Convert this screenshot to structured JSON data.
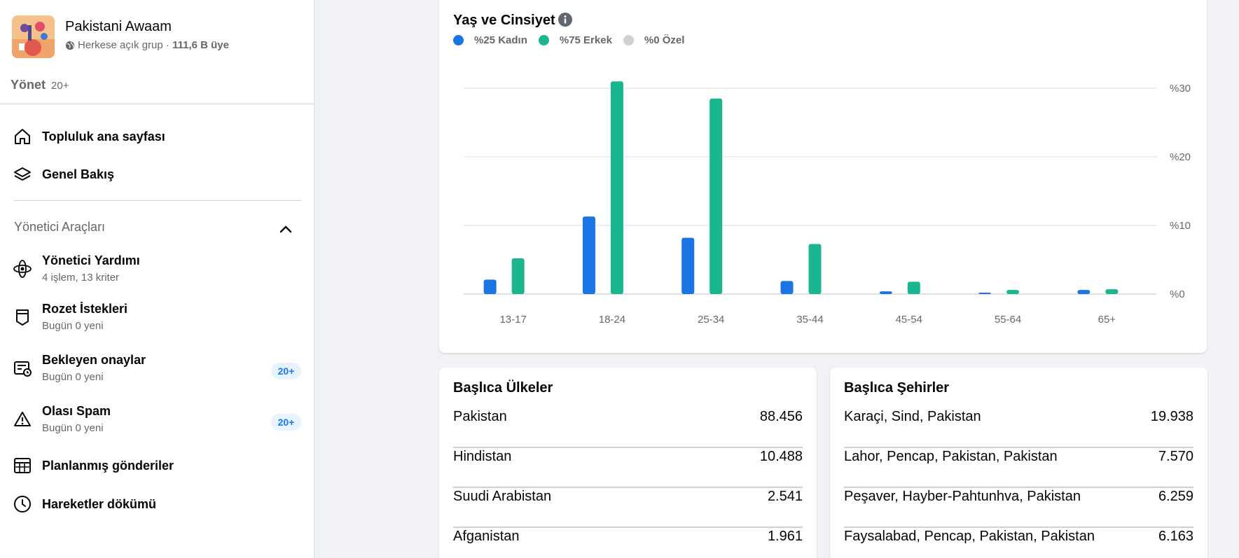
{
  "group": {
    "name": "Pakistani Awaam",
    "privacy": "Herkese açık grup",
    "separator": " · ",
    "members": "111,6 B üye"
  },
  "manage": {
    "label": "Yönet",
    "count": "20+"
  },
  "nav_main": [
    {
      "label": "Topluluk ana sayfası",
      "icon": "home-icon"
    },
    {
      "label": "Genel Bakış",
      "icon": "layers-icon"
    }
  ],
  "admin_tools": {
    "title": "Yönetici Araçları",
    "items": [
      {
        "label": "Yönetici Yardımı",
        "sub": "4 işlem, 13 kriter",
        "icon": "admin-assist-icon"
      },
      {
        "label": "Rozet İstekleri",
        "sub": "Bugün 0 yeni",
        "icon": "badge-icon"
      },
      {
        "label": "Bekleyen onaylar",
        "sub": "Bugün 0 yeni",
        "icon": "pending-icon",
        "badge": "20+"
      },
      {
        "label": "Olası Spam",
        "sub": "Bugün 0 yeni",
        "icon": "warning-icon",
        "badge": "20+"
      },
      {
        "label": "Planlanmış gönderiler",
        "icon": "calendar-icon"
      },
      {
        "label": "Hareketler dökümü",
        "icon": "clock-icon"
      }
    ]
  },
  "colors": {
    "women": "#1b74e4",
    "men": "#1ab690",
    "custom": "#ced0d4",
    "badge_text": "#1877f2"
  },
  "chart_title": "Yaş ve Cinsiyet",
  "legend": [
    {
      "label": "%25 Kadın",
      "color": "#1b74e4"
    },
    {
      "label": "%75 Erkek",
      "color": "#1ab690"
    },
    {
      "label": "%0 Özel",
      "color": "#ced0d4"
    }
  ],
  "chart_data": {
    "type": "bar",
    "title": "Yaş ve Cinsiyet",
    "categories": [
      "13-17",
      "18-24",
      "25-34",
      "35-44",
      "45-54",
      "55-64",
      "65+"
    ],
    "series": [
      {
        "name": "%25 Kadın",
        "values": [
          2.1,
          11.3,
          8.2,
          1.9,
          0.4,
          0.2,
          0.6
        ]
      },
      {
        "name": "%75 Erkek",
        "values": [
          5.2,
          31.0,
          28.5,
          7.3,
          1.8,
          0.6,
          0.7
        ]
      }
    ],
    "y_ticks": [
      "%30",
      "%20",
      "%10",
      "%0"
    ],
    "ylim": [
      0,
      30
    ],
    "grid": true
  },
  "countries": {
    "title": "Başlıca Ülkeler",
    "rows": [
      {
        "name": "Pakistan",
        "value": "88.456"
      },
      {
        "name": "Hindistan",
        "value": "10.488"
      },
      {
        "name": "Suudi Arabistan",
        "value": "2.541"
      },
      {
        "name": "Afganistan",
        "value": "1.961"
      }
    ]
  },
  "cities": {
    "title": "Başlıca Şehirler",
    "rows": [
      {
        "name": "Karaçi, Sind, Pakistan",
        "value": "19.938"
      },
      {
        "name": "Lahor, Pencap, Pakistan, Pakistan",
        "value": "7.570"
      },
      {
        "name": "Peşaver, Hayber-Pahtunhva, Pakistan",
        "value": "6.259"
      },
      {
        "name": "Faysalabad, Pencap, Pakistan, Pakistan",
        "value": "6.163"
      }
    ]
  }
}
